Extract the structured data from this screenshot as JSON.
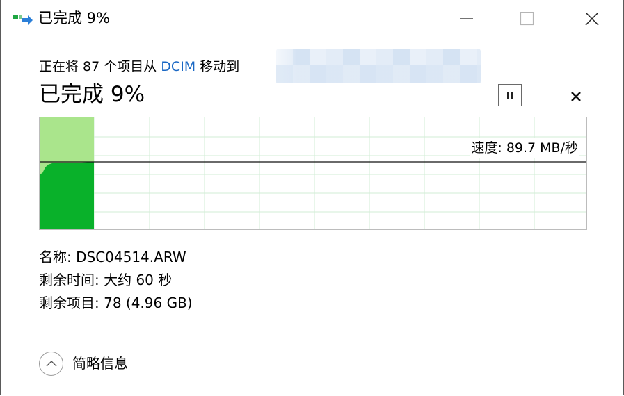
{
  "window": {
    "title": "已完成 9%",
    "icon": "file-move-icon",
    "controls": [
      "minimize",
      "maximize",
      "close"
    ]
  },
  "operation": {
    "prefix": "正在将 87 个项目从 ",
    "source_link": "DCIM",
    "suffix": " 移动到"
  },
  "progress": {
    "heading": "已完成 9%",
    "percent": 9
  },
  "graph": {
    "speed_label": "速度: 89.7 MB/秒",
    "colors": {
      "fill_done": "#09b12a",
      "fill_light": "#aae58c",
      "grid": "#d2ecd6"
    }
  },
  "details": {
    "name_row": "名称: DSC04514.ARW",
    "time_row": "剩余时间: 大约 60 秒",
    "items_row": "剩余项目: 78 (4.96 GB)"
  },
  "footer": {
    "less_info_label": "简略信息"
  }
}
